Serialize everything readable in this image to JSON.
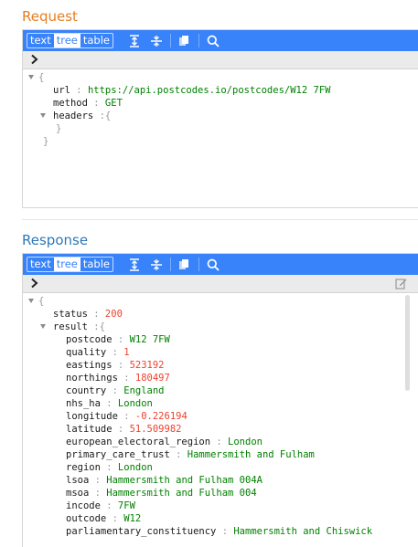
{
  "request": {
    "title": "Request",
    "modes": [
      "text",
      "tree",
      "table"
    ],
    "active_mode": "tree",
    "open_brace": "{",
    "close_brace": "}",
    "url_key": "url",
    "url_value": "https://api.postcodes.io/postcodes/W12 7FW",
    "method_key": "method",
    "method_value": "GET",
    "headers_key": "headers",
    "headers_open": "{",
    "headers_close": "}"
  },
  "response": {
    "title": "Response",
    "modes": [
      "text",
      "tree",
      "table"
    ],
    "active_mode": "tree",
    "open_brace": "{",
    "status_key": "status",
    "status_value": "200",
    "result_key": "result",
    "result_open": "{",
    "fields": [
      {
        "key": "postcode",
        "value": "W12 7FW",
        "type": "str"
      },
      {
        "key": "quality",
        "value": "1",
        "type": "num"
      },
      {
        "key": "eastings",
        "value": "523192",
        "type": "num"
      },
      {
        "key": "northings",
        "value": "180497",
        "type": "num"
      },
      {
        "key": "country",
        "value": "England",
        "type": "str"
      },
      {
        "key": "nhs_ha",
        "value": "London",
        "type": "str"
      },
      {
        "key": "longitude",
        "value": "-0.226194",
        "type": "num"
      },
      {
        "key": "latitude",
        "value": "51.509982",
        "type": "num"
      },
      {
        "key": "european_electoral_region",
        "value": "London",
        "type": "str"
      },
      {
        "key": "primary_care_trust",
        "value": "Hammersmith and Fulham",
        "type": "str"
      },
      {
        "key": "region",
        "value": "London",
        "type": "str"
      },
      {
        "key": "lsoa",
        "value": "Hammersmith and Fulham 004A",
        "type": "str"
      },
      {
        "key": "msoa",
        "value": "Hammersmith and Fulham 004",
        "type": "str"
      },
      {
        "key": "incode",
        "value": "7FW",
        "type": "str"
      },
      {
        "key": "outcode",
        "value": "W12",
        "type": "str"
      },
      {
        "key": "parliamentary_constituency",
        "value": "Hammersmith and Chiswick",
        "type": "str"
      }
    ]
  },
  "separator": ":",
  "colors": {
    "toolbar": "#3883fa",
    "request_title": "#e67e22",
    "response_title": "#2f78b7",
    "string_value": "#008000",
    "number_value": "#ee422e"
  }
}
